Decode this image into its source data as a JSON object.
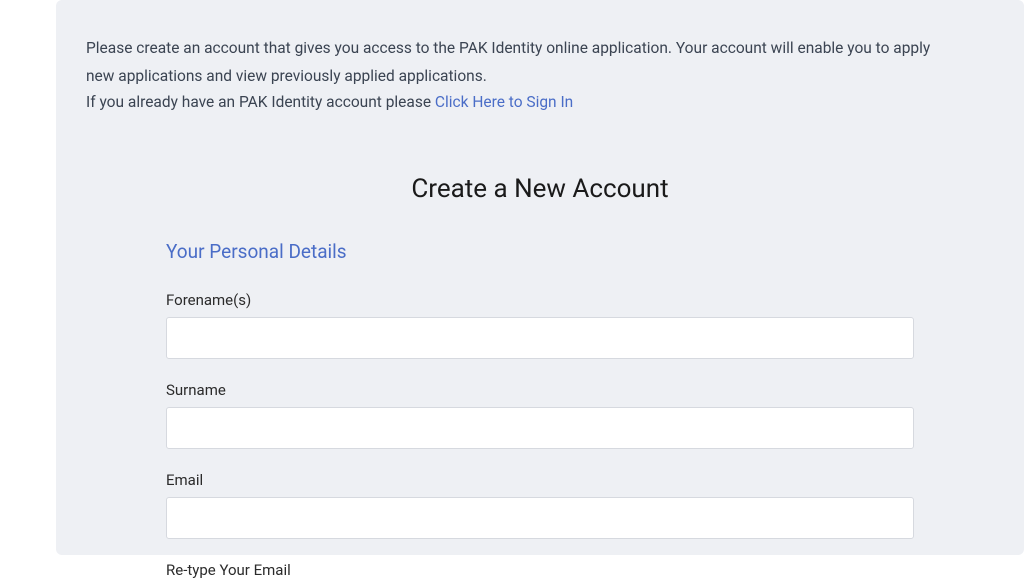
{
  "intro": {
    "line1": "Please create an account that gives you access to the PAK Identity online application. Your account will enable you to apply",
    "line2": "new applications and view previously applied applications.",
    "line3_prefix": "If you already have an PAK Identity account please ",
    "signin_link": "Click Here to Sign In"
  },
  "form": {
    "title": "Create a New Account",
    "section_header": "Your Personal Details",
    "fields": {
      "forename": {
        "label": "Forename(s)",
        "value": ""
      },
      "surname": {
        "label": "Surname",
        "value": ""
      },
      "email": {
        "label": "Email",
        "value": ""
      },
      "retype_email": {
        "label": "Re-type Your Email",
        "value": ""
      }
    }
  }
}
